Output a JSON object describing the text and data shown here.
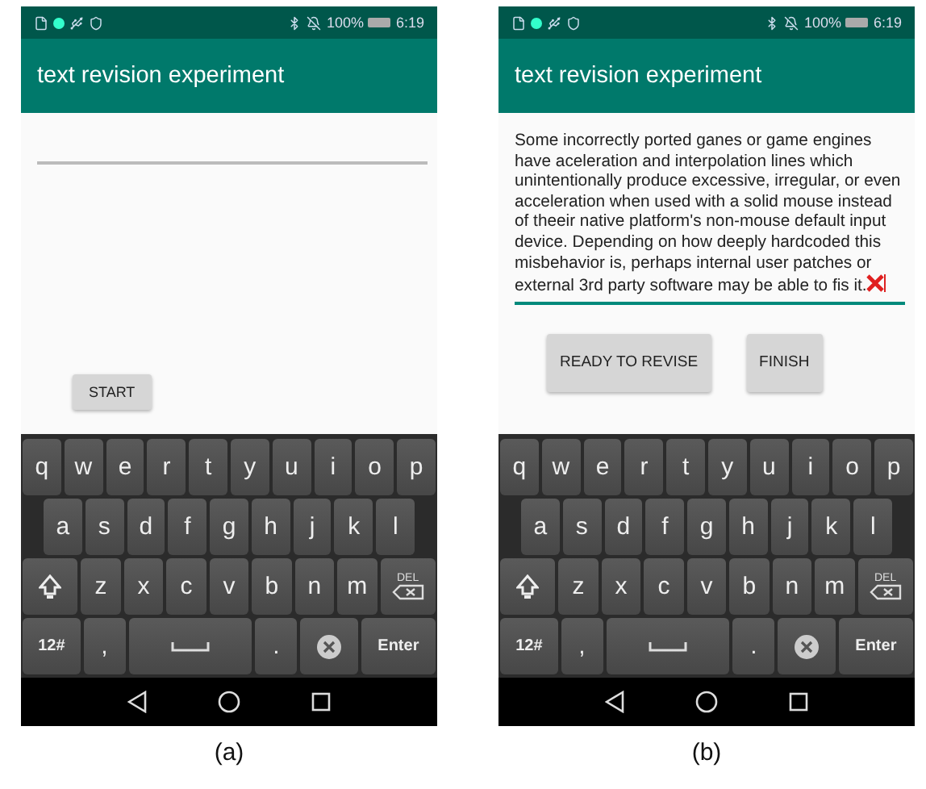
{
  "panels": [
    {
      "caption": "(a)",
      "status_bar": {
        "battery": "100%",
        "time": "6:19"
      },
      "title": "text revision experiment",
      "field": {
        "focused": false,
        "cursor": false
      },
      "buttons": [
        {
          "label": "START"
        }
      ],
      "keyboard": [
        [
          {
            "kind": "char",
            "label": "q"
          },
          {
            "kind": "char",
            "label": "w"
          },
          {
            "kind": "char",
            "label": "e"
          },
          {
            "kind": "char",
            "label": "r"
          },
          {
            "kind": "char",
            "label": "t"
          },
          {
            "kind": "char",
            "label": "y"
          },
          {
            "kind": "char",
            "label": "u"
          },
          {
            "kind": "char",
            "label": "i"
          },
          {
            "kind": "char",
            "label": "o"
          },
          {
            "kind": "char",
            "label": "p"
          }
        ],
        [
          {
            "kind": "char",
            "label": "a"
          },
          {
            "kind": "char",
            "label": "s"
          },
          {
            "kind": "char",
            "label": "d"
          },
          {
            "kind": "char",
            "label": "f"
          },
          {
            "kind": "char",
            "label": "g"
          },
          {
            "kind": "char",
            "label": "h"
          },
          {
            "kind": "char",
            "label": "j"
          },
          {
            "kind": "char",
            "label": "k"
          },
          {
            "kind": "char",
            "label": "l"
          }
        ],
        [
          {
            "kind": "shift"
          },
          {
            "kind": "char",
            "label": "z"
          },
          {
            "kind": "char",
            "label": "x"
          },
          {
            "kind": "char",
            "label": "c"
          },
          {
            "kind": "char",
            "label": "v"
          },
          {
            "kind": "char",
            "label": "b"
          },
          {
            "kind": "char",
            "label": "n"
          },
          {
            "kind": "char",
            "label": "m"
          },
          {
            "kind": "del",
            "label": "DEL"
          }
        ],
        [
          {
            "kind": "symbols",
            "label": "12#"
          },
          {
            "kind": "char",
            "label": ","
          },
          {
            "kind": "space"
          },
          {
            "kind": "char",
            "label": "."
          },
          {
            "kind": "emoji"
          },
          {
            "kind": "enter",
            "label": "Enter"
          }
        ]
      ]
    },
    {
      "caption": "(b)",
      "status_bar": {
        "battery": "100%",
        "time": "6:19"
      },
      "title": "text revision experiment",
      "field": {
        "value": "Some incorrectly ported ganes or game engines have aceleration and interpolation lines which unintentionally produce excessive, irregular, or even acceleration when used with a solid mouse instead of theeir native platform's non-mouse default input device. Depending on how deeply hardcoded this misbehavior is, perhaps internal user patches or external 3rd party software may be able to fis it.",
        "focused": true,
        "cursor": true
      },
      "buttons": [
        {
          "label": "READY TO REVISE"
        },
        {
          "label": "FINISH"
        }
      ],
      "keyboard": [
        [
          {
            "kind": "char",
            "label": "q"
          },
          {
            "kind": "char",
            "label": "w"
          },
          {
            "kind": "char",
            "label": "e"
          },
          {
            "kind": "char",
            "label": "r"
          },
          {
            "kind": "char",
            "label": "t"
          },
          {
            "kind": "char",
            "label": "y"
          },
          {
            "kind": "char",
            "label": "u"
          },
          {
            "kind": "char",
            "label": "i"
          },
          {
            "kind": "char",
            "label": "o"
          },
          {
            "kind": "char",
            "label": "p"
          }
        ],
        [
          {
            "kind": "char",
            "label": "a"
          },
          {
            "kind": "char",
            "label": "s"
          },
          {
            "kind": "char",
            "label": "d"
          },
          {
            "kind": "char",
            "label": "f"
          },
          {
            "kind": "char",
            "label": "g"
          },
          {
            "kind": "char",
            "label": "h"
          },
          {
            "kind": "char",
            "label": "j"
          },
          {
            "kind": "char",
            "label": "k"
          },
          {
            "kind": "char",
            "label": "l"
          }
        ],
        [
          {
            "kind": "shift"
          },
          {
            "kind": "char",
            "label": "z"
          },
          {
            "kind": "char",
            "label": "x"
          },
          {
            "kind": "char",
            "label": "c"
          },
          {
            "kind": "char",
            "label": "v"
          },
          {
            "kind": "char",
            "label": "b"
          },
          {
            "kind": "char",
            "label": "n"
          },
          {
            "kind": "char",
            "label": "m"
          },
          {
            "kind": "del",
            "label": "DEL"
          }
        ],
        [
          {
            "kind": "symbols",
            "label": "12#"
          },
          {
            "kind": "char",
            "label": ","
          },
          {
            "kind": "space"
          },
          {
            "kind": "char",
            "label": "."
          },
          {
            "kind": "emoji"
          },
          {
            "kind": "enter",
            "label": "Enter"
          }
        ]
      ]
    }
  ]
}
